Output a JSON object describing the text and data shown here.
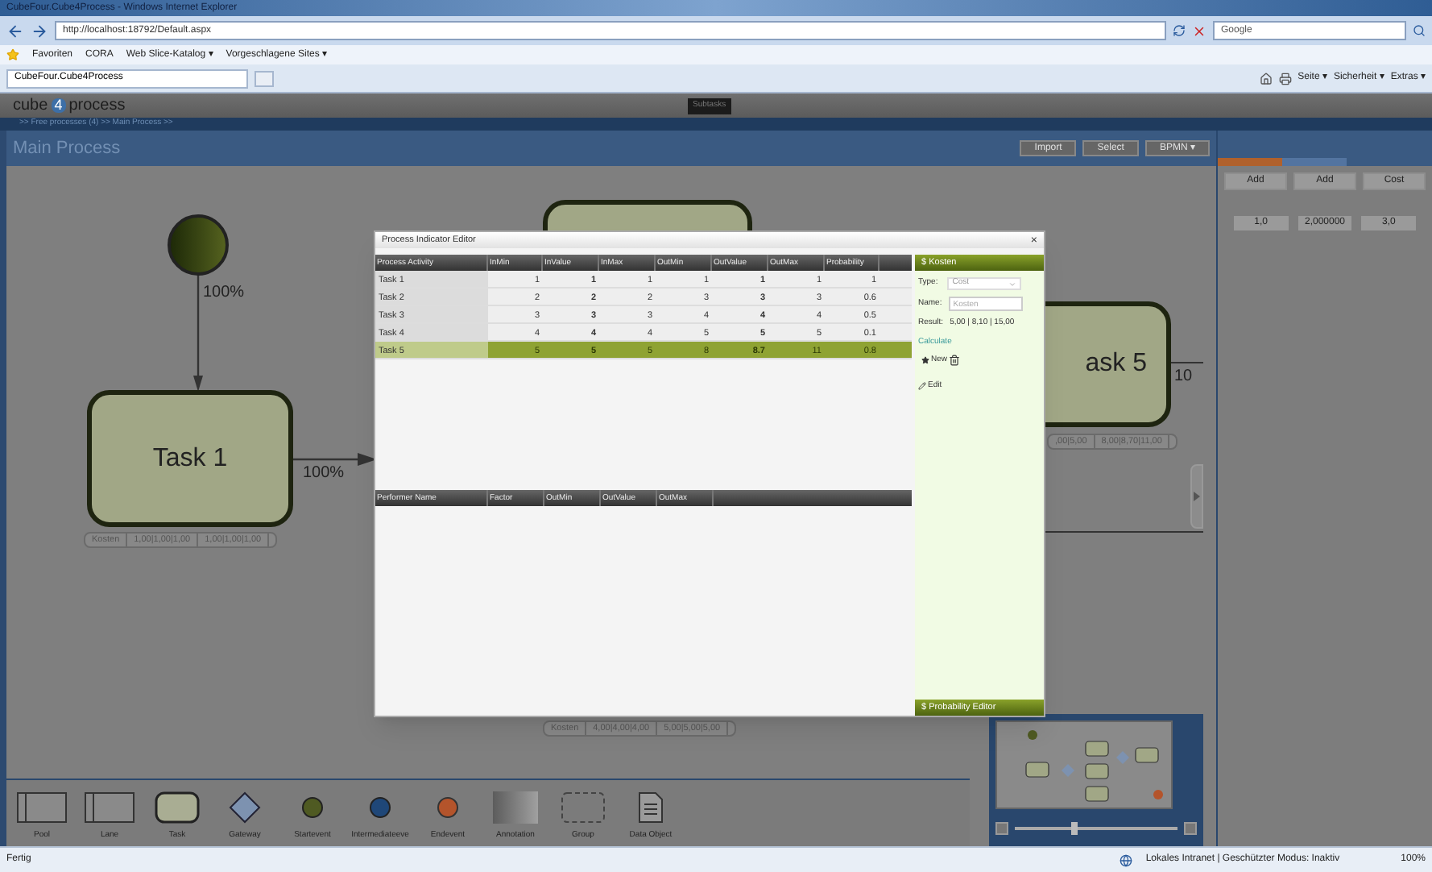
{
  "browser": {
    "title": "CubeFour.Cube4Process - Windows Internet Explorer",
    "address": "http://localhost:18792/Default.aspx",
    "search_placeholder": "Google",
    "favorites": [
      "Favoriten",
      "CORA",
      "Web Slice-Katalog ▾",
      "Vorgeschlagene Sites ▾"
    ],
    "tabs": [
      {
        "label": "CubeFour.Cube4Process",
        "selected": true
      }
    ],
    "commands": [
      "Seite ▾",
      "Sicherheit ▾",
      "Extras ▾"
    ]
  },
  "app": {
    "logo_left": "cube",
    "logo_mark": "4",
    "logo_right": "process",
    "center_label": "Subtasks",
    "breadcrumb": ">> Free processes (4) >> Main Process >>",
    "title": "Main Process",
    "buttons": [
      "Import",
      "Select",
      "BPMN ▾"
    ]
  },
  "minimap": {
    "zoom_slider": {
      "level": 0.35
    }
  },
  "side_panel": {
    "buttons": [
      "Add",
      "Add",
      "Cost"
    ],
    "values": [
      "1,0",
      "2,000000",
      "3,0"
    ]
  },
  "diagram": {
    "edge_labels": [
      "100%",
      "100%",
      "10"
    ],
    "tasks": [
      {
        "label": "Task 1",
        "metrics": [
          "Kosten",
          "1,00|1,00|1,00",
          "1,00|1,00|1,00"
        ]
      },
      {
        "label": "ask 5",
        "metrics": [
          ",00|5,00",
          "8,00|8,70|11,00"
        ]
      }
    ],
    "hidden_task_metrics": [
      "Kosten",
      "4,00|4,00|4,00",
      "5,00|5,00|5,00"
    ]
  },
  "editor": {
    "title": "Process Indicator Editor",
    "close": "×",
    "columns": [
      "Process Activity",
      "InMin",
      "InValue",
      "InMax",
      "OutMin",
      "OutValue",
      "OutMax",
      "Probability"
    ],
    "rows": [
      {
        "cells": [
          "Task 1",
          "1",
          "1",
          "1",
          "1",
          "1",
          "1",
          "1"
        ],
        "selected": false
      },
      {
        "cells": [
          "Task 2",
          "2",
          "2",
          "2",
          "3",
          "3",
          "3",
          "0.6"
        ],
        "selected": false
      },
      {
        "cells": [
          "Task 3",
          "3",
          "3",
          "3",
          "4",
          "4",
          "4",
          "0.5"
        ],
        "selected": false
      },
      {
        "cells": [
          "Task 4",
          "4",
          "4",
          "4",
          "5",
          "5",
          "5",
          "0.1"
        ],
        "selected": false
      },
      {
        "cells": [
          "Task 5",
          "5",
          "5",
          "5",
          "8",
          "8.7",
          "11",
          "0.8"
        ],
        "selected": true
      }
    ],
    "performer_columns": [
      "Performer Name",
      "Factor",
      "OutMin",
      "OutValue",
      "OutMax"
    ],
    "panel": {
      "title": "$ Kosten",
      "type_label": "Type:",
      "type_value": "Cost",
      "name_label": "Name:",
      "name_placeholder": "Kosten",
      "result_label": "Result:",
      "result_value": "5,00 | 8,10 | 15,00",
      "calculate": "Calculate",
      "new": "New",
      "edit": "Edit",
      "footer": "$ Probability Editor"
    }
  },
  "toolbox": [
    {
      "label": "Pool",
      "kind": "pool"
    },
    {
      "label": "Lane",
      "kind": "lane"
    },
    {
      "label": "Task",
      "kind": "task"
    },
    {
      "label": "Gateway",
      "kind": "gateway"
    },
    {
      "label": "Startevent",
      "kind": "start"
    },
    {
      "label": "Intermediateeve",
      "kind": "intermediate"
    },
    {
      "label": "Endevent",
      "kind": "end"
    },
    {
      "label": "Annotation",
      "kind": "annotation"
    },
    {
      "label": "Group",
      "kind": "group"
    },
    {
      "label": "Data Object",
      "kind": "data"
    }
  ],
  "status_bar": {
    "text": "Fertig",
    "zone": "Lokales Intranet | Geschützter Modus: Inaktiv",
    "zoom": "100%"
  }
}
